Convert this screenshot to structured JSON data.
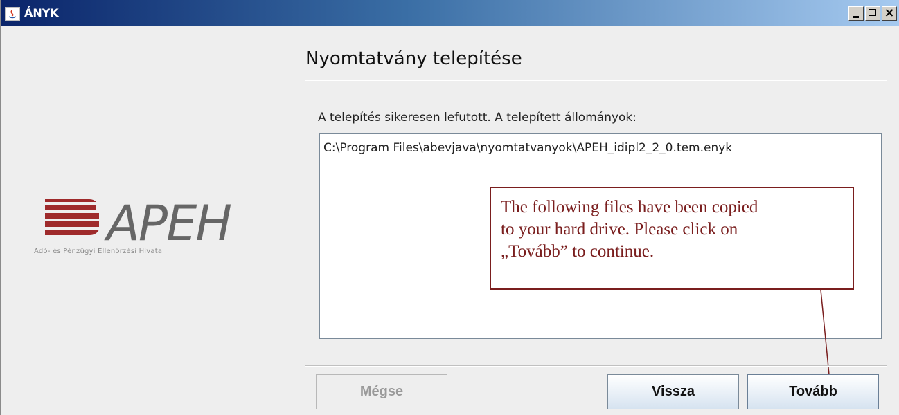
{
  "window": {
    "title": "ÁNYK"
  },
  "page": {
    "title": "Nyomtatvány telepítése",
    "success_label": "A telepítés sikeresen lefutott. A telepített állományok:",
    "installed_files": [
      "C:\\Program Files\\abevjava\\nyomtatvanyok\\APEH_idipl2_2_0.tem.enyk"
    ]
  },
  "logo": {
    "text": "APEH",
    "subtitle": "Adó- és Pénzügyi Ellenőrzési Hivatal"
  },
  "callout": {
    "text": "The following files have been copied\nto your hard drive. Please click on\n„Tovább” to continue."
  },
  "buttons": {
    "cancel": "Mégse",
    "back": "Vissza",
    "next": "Tovább"
  },
  "colors": {
    "titlebar_start": "#0a246a",
    "titlebar_end": "#a6caf0",
    "callout_border": "#7a1e1e",
    "logo_red": "#9e2a2b"
  }
}
